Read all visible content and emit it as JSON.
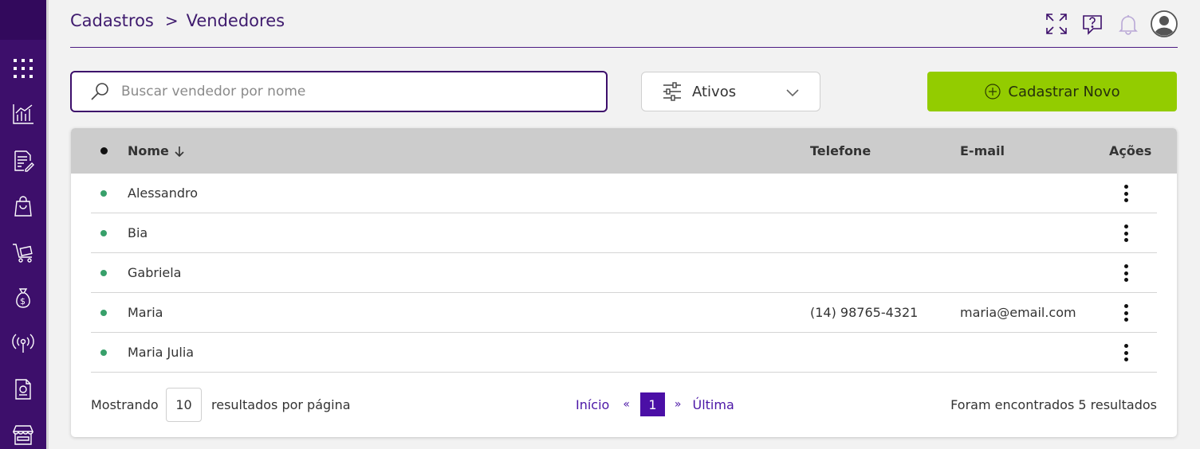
{
  "sidebar": {
    "items": [
      {
        "icon": "apps-grid-icon"
      },
      {
        "icon": "chart-icon"
      },
      {
        "icon": "document-edit-icon"
      },
      {
        "icon": "shopping-bag-icon"
      },
      {
        "icon": "cart-icon"
      },
      {
        "icon": "money-bag-icon"
      },
      {
        "icon": "broadcast-icon"
      },
      {
        "icon": "report-icon"
      },
      {
        "icon": "store-icon"
      }
    ]
  },
  "header": {
    "breadcrumb": {
      "parent": "Cadastros",
      "separator": ">",
      "current": "Vendedores"
    },
    "icons": [
      "fullscreen-icon",
      "help-icon",
      "bell-icon",
      "user-avatar-icon"
    ]
  },
  "toolbar": {
    "search_placeholder": "Buscar vendedor por nome",
    "search_value": "",
    "filter_label": "Ativos",
    "cta_label": "Cadastrar Novo"
  },
  "table": {
    "columns": {
      "name": "Nome",
      "phone": "Telefone",
      "email": "E-mail",
      "actions": "Ações"
    },
    "rows": [
      {
        "name": "Alessandro",
        "phone": "",
        "email": ""
      },
      {
        "name": "Bia",
        "phone": "",
        "email": ""
      },
      {
        "name": "Gabriela",
        "phone": "",
        "email": ""
      },
      {
        "name": "Maria",
        "phone": "(14) 98765-4321",
        "email": "maria@email.com"
      },
      {
        "name": "Maria Julia",
        "phone": "",
        "email": ""
      }
    ]
  },
  "footer": {
    "showing_label": "Mostrando",
    "per_page": "10",
    "per_page_label": "resultados por página",
    "pager": {
      "first": "Início",
      "prev": "«",
      "current": "1",
      "next": "»",
      "last": "Última"
    },
    "found_text": "Foram encontrados 5 resultados"
  },
  "colors": {
    "sidebar": "#3d0f6b",
    "accent": "#4b0fa6",
    "cta": "#93cc00",
    "active_status": "#37a06a",
    "table_header": "#cccccc"
  }
}
